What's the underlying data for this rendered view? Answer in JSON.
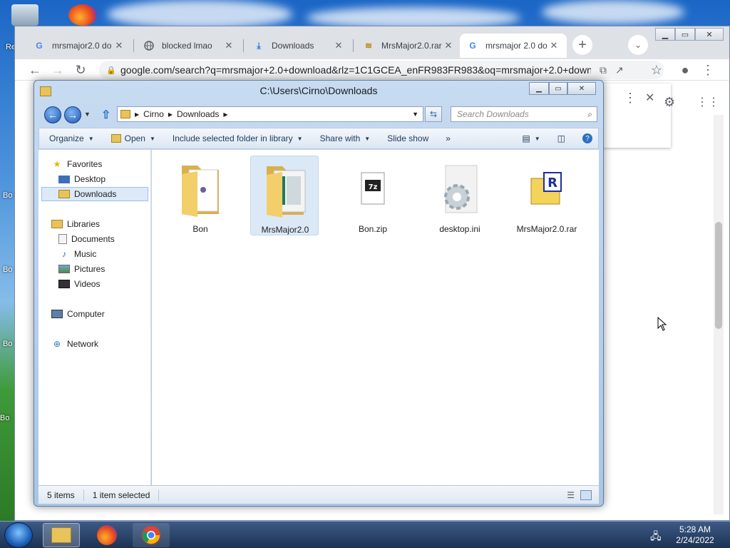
{
  "chrome": {
    "tabs": [
      {
        "title": "mrsmajor2.0 do",
        "icon": "google-g-icon"
      },
      {
        "title": "blocked lmao",
        "icon": "globe-icon"
      },
      {
        "title": "Downloads",
        "icon": "download-icon"
      },
      {
        "title": "MrsMajor2.0.rar",
        "icon": "archive-icon"
      },
      {
        "title": "mrsmajor 2.0 do",
        "icon": "google-g-icon"
      }
    ],
    "url": "google.com/search?q=mrsmajor+2.0+download&rlz=1C1GCEA_enFR983FR983&oq=mrsmajor+2.0+down..."
  },
  "explorer": {
    "title": "C:\\Users\\Cirno\\Downloads",
    "breadcrumb": [
      "Cirno",
      "Downloads"
    ],
    "search_placeholder": "Search Downloads",
    "commands": {
      "organize": "Organize",
      "open": "Open",
      "include": "Include selected folder in library",
      "share": "Share with",
      "slideshow": "Slide show",
      "more": "»"
    },
    "nav": {
      "favorites": "Favorites",
      "desktop": "Desktop",
      "downloads": "Downloads",
      "libraries": "Libraries",
      "documents": "Documents",
      "music": "Music",
      "pictures": "Pictures",
      "videos": "Videos",
      "computer": "Computer",
      "network": "Network"
    },
    "files": [
      {
        "name": "Bon",
        "type": "folder"
      },
      {
        "name": "MrsMajor2.0",
        "type": "folder"
      },
      {
        "name": "Bon.zip",
        "type": "7z-archive"
      },
      {
        "name": "desktop.ini",
        "type": "config-file"
      },
      {
        "name": "MrsMajor2.0.rar",
        "type": "rar-archive"
      }
    ],
    "status": {
      "count": "5 items",
      "selected": "1 item selected"
    }
  },
  "desktop": {
    "icon_labels": [
      "Bo",
      "Bo",
      "Bo",
      "Bo",
      "Re"
    ]
  },
  "taskbar": {
    "time": "5:28 AM",
    "date": "2/24/2022"
  }
}
